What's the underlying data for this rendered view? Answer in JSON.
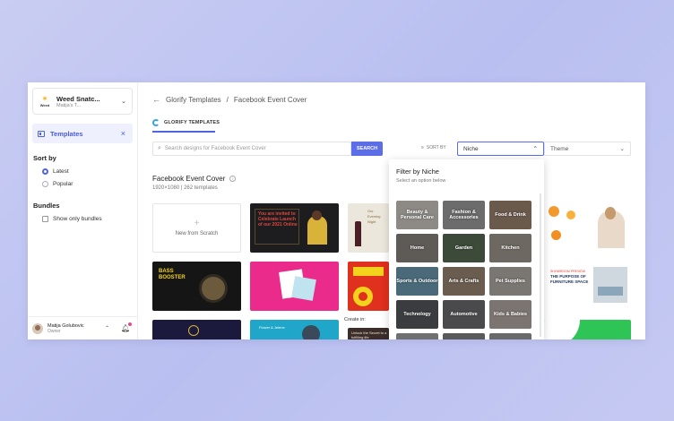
{
  "workspace": {
    "name": "Weed Snatc...",
    "sub": "Matija's T...",
    "logo_text": "Weed"
  },
  "sidebar": {
    "templates_label": "Templates",
    "sort_heading": "Sort by",
    "sort_options": [
      "Latest",
      "Popular"
    ],
    "bundles_heading": "Bundles",
    "bundles_option": "Show only bundles"
  },
  "user": {
    "name": "Matija Golubovic",
    "role": "Owner"
  },
  "breadcrumb": {
    "root": "Glorify Templates",
    "sep": "/",
    "current": "Facebook Event Cover"
  },
  "tab": {
    "label": "GLORIFY TEMPLATES"
  },
  "search": {
    "placeholder": "Search designs for Facebook Event Cover",
    "button": "SEARCH"
  },
  "sort_by_label": "SORT BY",
  "niche_select": "Niche",
  "theme_select": "Theme",
  "section": {
    "title": "Facebook Event Cover",
    "subtitle": "1920×1080 | 262 templates"
  },
  "new_card_label": "New from Scratch",
  "create_in": "Create in:",
  "cards": {
    "event": "You are invited to Celebrate Launch of our 2021 Online",
    "bass": "BASS BOOSTER",
    "invest": "Our Evening Night",
    "furniture": "THE PURPOSE OF FURNITURE SPACE",
    "furniture_tag": "SHOWROOM PREVIEW",
    "retreat": "Flower & Jelene",
    "unlock": "Unlock the Secret to a fulfilling life"
  },
  "dropdown": {
    "title": "Filter by Niche",
    "subtitle": "Select an option below",
    "options": [
      "Beauty & Personal Care",
      "Fashion & Accessories",
      "Food & Drink",
      "Home",
      "Garden",
      "Kitchen",
      "Sports & Outdoor",
      "Arts & Crafts",
      "Pet Supplies",
      "Technology",
      "Automotive",
      "Kids & Babies"
    ]
  },
  "colors": {
    "accent": "#5b6ee8",
    "bg": "#c3c7f2"
  }
}
